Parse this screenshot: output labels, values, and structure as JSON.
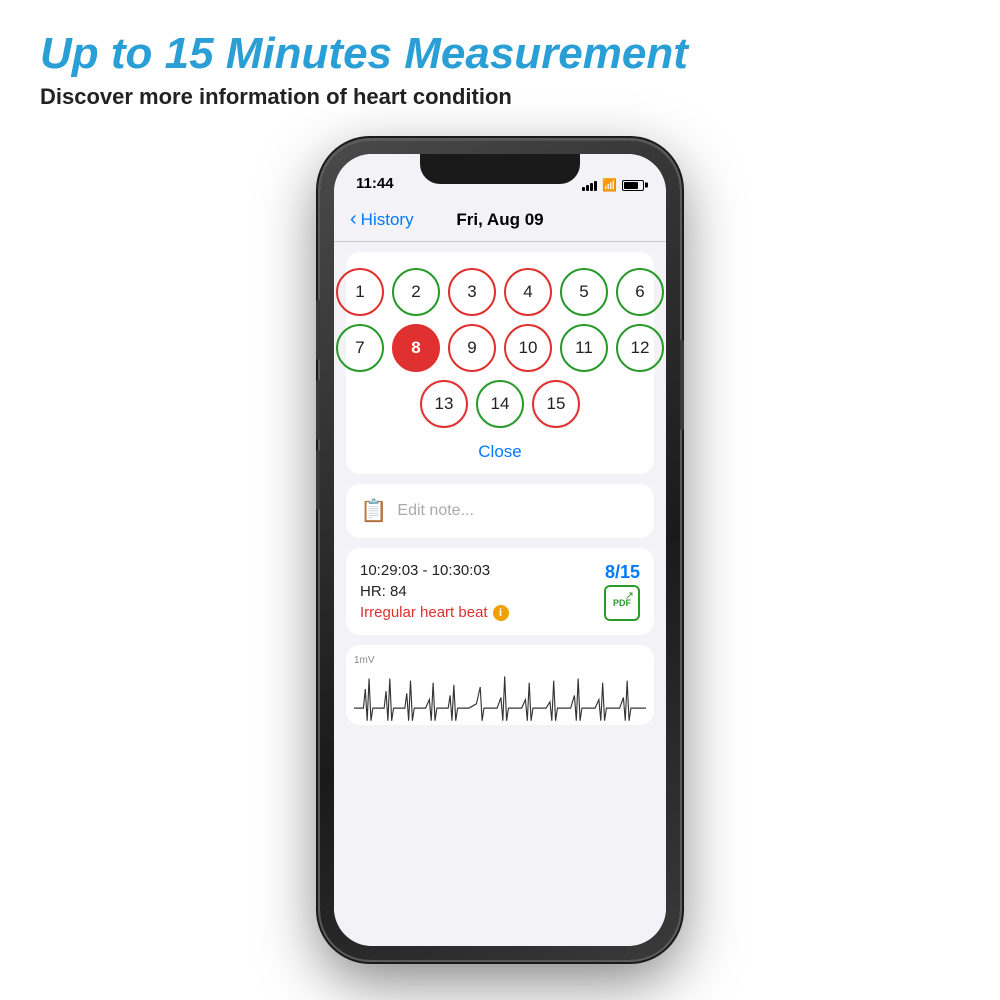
{
  "header": {
    "main_title": "Up to 15 Minutes Measurement",
    "sub_title": "Discover more information of heart condition"
  },
  "status_bar": {
    "time": "11:44"
  },
  "nav": {
    "back_label": "History",
    "title": "Fri, Aug 09"
  },
  "segment_picker": {
    "close_label": "Close",
    "segments": [
      {
        "number": "1",
        "style": "red-border"
      },
      {
        "number": "2",
        "style": "green-border"
      },
      {
        "number": "3",
        "style": "red-border"
      },
      {
        "number": "4",
        "style": "red-border"
      },
      {
        "number": "5",
        "style": "green-border"
      },
      {
        "number": "6",
        "style": "green-border"
      },
      {
        "number": "7",
        "style": "green-border"
      },
      {
        "number": "8",
        "style": "selected"
      },
      {
        "number": "9",
        "style": "red-border"
      },
      {
        "number": "10",
        "style": "red-border"
      },
      {
        "number": "11",
        "style": "green-border"
      },
      {
        "number": "12",
        "style": "green-border"
      },
      {
        "number": "13",
        "style": "red-border"
      },
      {
        "number": "14",
        "style": "green-border"
      },
      {
        "number": "15",
        "style": "red-border"
      }
    ]
  },
  "note": {
    "placeholder": "Edit note..."
  },
  "reading": {
    "time_range": "10:29:03 - 10:30:03",
    "hr_label": "HR: 84",
    "status": "Irregular heart beat",
    "badge": "8/15",
    "pdf_label": "PDF"
  },
  "ecg": {
    "label": "1mV"
  }
}
